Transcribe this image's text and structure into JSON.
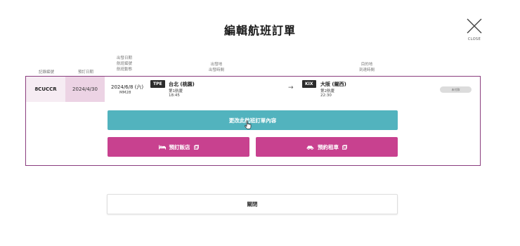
{
  "dialog": {
    "title": "編輯航班訂單",
    "close_label": "CLOSE"
  },
  "columns": {
    "record_no": "記錄編號",
    "booking_date": "預訂日期",
    "flight_info": [
      "出發日期",
      "航班編號",
      "航班動態"
    ],
    "departure": [
      "出發地",
      "出發時間"
    ],
    "destination": [
      "目的地",
      "到達時間"
    ]
  },
  "order": {
    "record_no": "8CUCCR",
    "booking_date": "2024/4/30",
    "departure_date": "2024/6/8 (六)",
    "flight_no": "MM28",
    "origin": {
      "iata": "TPE",
      "city": "台北 (桃園)",
      "terminal": "第1航廈",
      "time": "18:45"
    },
    "arrow": "→",
    "destination": {
      "iata": "KIX",
      "city": "大阪 (關西)",
      "terminal": "第2航廈",
      "time": "22:30"
    },
    "status": "未付款"
  },
  "actions": {
    "edit_label": "更改此航班訂單內容",
    "hotel_label": "預訂飯店",
    "car_label": "預約租車",
    "close_dialog_label": "關閉"
  },
  "colors": {
    "frame": "#8a3d7e",
    "teal": "#52b3be",
    "magenta": "#c8418f",
    "code_bg": "#f6ecf3",
    "date_bg": "#ecd3e4"
  },
  "icons": [
    "close-icon",
    "bed-icon",
    "external-link-icon",
    "car-icon",
    "hand-cursor-icon"
  ]
}
